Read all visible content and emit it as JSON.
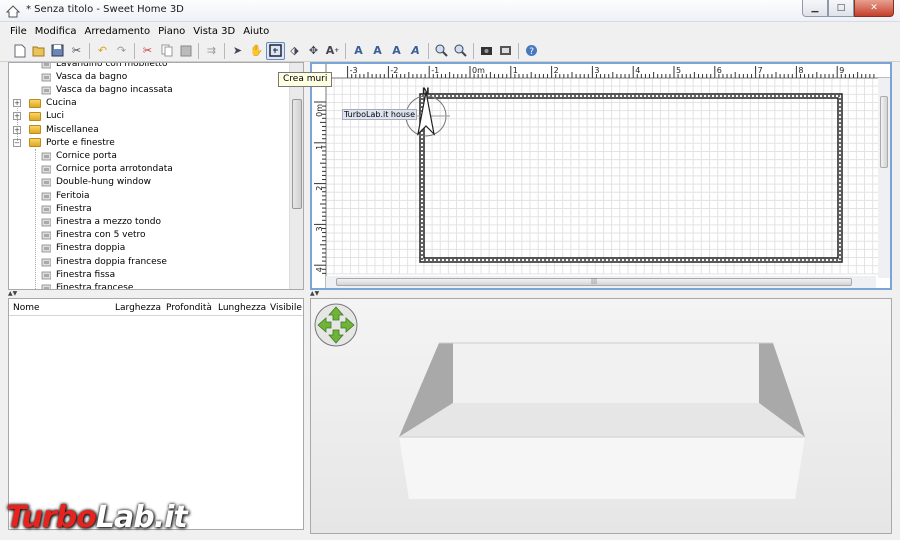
{
  "window": {
    "title": "* Senza titolo - Sweet Home 3D"
  },
  "menu": [
    "File",
    "Modifica",
    "Arredamento",
    "Piano",
    "Vista 3D",
    "Aiuto"
  ],
  "toolbar": {
    "tooltip": "Crea muri",
    "icons": [
      "new-icon",
      "open-icon",
      "save-icon",
      "preferences-icon",
      "undo-icon",
      "redo-icon",
      "cut-icon",
      "copy-icon",
      "paste-icon",
      "add-furniture-icon",
      "select-icon",
      "pan-icon",
      "create-walls-icon",
      "create-rooms-icon",
      "create-dimensions-icon",
      "add-text-icon",
      "text-style-icon",
      "zoom-in-icon",
      "zoom-out-icon",
      "photo-icon",
      "video-icon",
      "help-icon"
    ]
  },
  "catalog": {
    "items": [
      {
        "label": "Lavandino con mobiletto",
        "level": 2,
        "type": "item",
        "icon": "sink-icon"
      },
      {
        "label": "Vasca da bagno",
        "level": 2,
        "type": "item",
        "icon": "bathtub-icon"
      },
      {
        "label": "Vasca da bagno incassata",
        "level": 2,
        "type": "item",
        "icon": "bathtub-icon"
      },
      {
        "label": "Cucina",
        "level": 1,
        "type": "folder",
        "icon": "folder-icon"
      },
      {
        "label": "Luci",
        "level": 1,
        "type": "folder",
        "icon": "folder-icon"
      },
      {
        "label": "Miscellanea",
        "level": 1,
        "type": "folder",
        "icon": "folder-icon"
      },
      {
        "label": "Porte e finestre",
        "level": 1,
        "type": "folder-open",
        "icon": "folder-icon"
      },
      {
        "label": "Cornice porta",
        "level": 2,
        "type": "item",
        "icon": "door-frame-icon"
      },
      {
        "label": "Cornice porta arrotondata",
        "level": 2,
        "type": "item",
        "icon": "door-frame-icon"
      },
      {
        "label": "Double-hung window",
        "level": 2,
        "type": "item",
        "icon": "window-icon"
      },
      {
        "label": "Feritoia",
        "level": 2,
        "type": "item",
        "icon": "window-icon"
      },
      {
        "label": "Finestra",
        "level": 2,
        "type": "item",
        "icon": "window-icon"
      },
      {
        "label": "Finestra a mezzo tondo",
        "level": 2,
        "type": "item",
        "icon": "half-round-window-icon"
      },
      {
        "label": "Finestra con 5 vetro",
        "level": 2,
        "type": "item",
        "icon": "window-icon"
      },
      {
        "label": "Finestra doppia",
        "level": 2,
        "type": "item",
        "icon": "window-icon"
      },
      {
        "label": "Finestra doppia francese",
        "level": 2,
        "type": "item",
        "icon": "window-icon"
      },
      {
        "label": "Finestra fissa",
        "level": 2,
        "type": "item",
        "icon": "window-icon"
      },
      {
        "label": "Finestra francese",
        "level": 2,
        "type": "item",
        "icon": "window-icon"
      }
    ]
  },
  "furniture_table": {
    "columns": [
      "Nome",
      "Larghezza",
      "Profondità",
      "Lunghezza",
      "Visibile"
    ]
  },
  "plan": {
    "x_ruler": [
      "-3",
      "-2",
      "-1",
      "0m",
      "1",
      "2",
      "3",
      "4",
      "5",
      "6",
      "7",
      "8",
      "9"
    ],
    "y_ruler": [
      "0m",
      "1",
      "2",
      "3",
      "4"
    ],
    "compass_label": "TurboLab.it house",
    "north_label": "N"
  },
  "watermark": {
    "part1": "Turbo",
    "part2": "Lab",
    "part3": ".it"
  },
  "colors": {
    "accent": "#7aa5d6",
    "folder": "#e8b53a",
    "arrows": "#6fb33a"
  }
}
